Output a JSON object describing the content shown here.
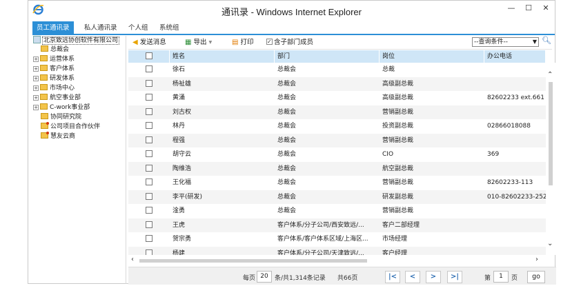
{
  "window": {
    "title": "通讯录 - Windows Internet Explorer"
  },
  "tabs": [
    {
      "label": "员工通讯录",
      "active": true
    },
    {
      "label": "私人通讯录",
      "active": false
    },
    {
      "label": "个人组",
      "active": false
    },
    {
      "label": "系统组",
      "active": false
    }
  ],
  "tree": {
    "root": "北京致远协创软件有限公司",
    "nodes": [
      {
        "label": "总裁会",
        "expandable": false
      },
      {
        "label": "运营体系",
        "expandable": true
      },
      {
        "label": "客户体系",
        "expandable": true
      },
      {
        "label": "研发体系",
        "expandable": true
      },
      {
        "label": "市场中心",
        "expandable": true
      },
      {
        "label": "航空事业部",
        "expandable": true
      },
      {
        "label": "C-work事业部",
        "expandable": true
      },
      {
        "label": "协同研究院",
        "expandable": false
      },
      {
        "label": "公司项目合作伙伴",
        "expandable": false,
        "icon": "partner"
      },
      {
        "label": "慧友云商",
        "expandable": false,
        "icon": "partner"
      }
    ]
  },
  "toolbar": {
    "send": "发送消息",
    "export": "导出",
    "print": "打印",
    "include_sub": "含子部门成员",
    "query_select": "--查询条件--"
  },
  "grid": {
    "columns": [
      "姓名",
      "部门",
      "岗位",
      "办公电话"
    ],
    "rows": [
      [
        "徐石",
        "总裁会",
        "总裁",
        ""
      ],
      [
        "杨祉雄",
        "总裁会",
        "高级副总裁",
        ""
      ],
      [
        "黄涌",
        "总裁会",
        "高级副总裁",
        "82602233 ext.661"
      ],
      [
        "刘古权",
        "总裁会",
        "营销副总裁",
        ""
      ],
      [
        "林丹",
        "总裁会",
        "投资副总裁",
        "02866018088"
      ],
      [
        "程强",
        "总裁会",
        "营销副总裁",
        ""
      ],
      [
        "胡守云",
        "总裁会",
        "CIO",
        "369"
      ],
      [
        "陶维浩",
        "总裁会",
        "航空副总裁",
        ""
      ],
      [
        "王化福",
        "总裁会",
        "营销副总裁",
        "82602233-113"
      ],
      [
        "李平(研发)",
        "总裁会",
        "研发副总裁",
        "010-82602233-252"
      ],
      [
        "淦勇",
        "总裁会",
        "营销副总裁",
        ""
      ],
      [
        "王虎",
        "客户体系/分子公司/西安致远/...",
        "客户二部经理",
        ""
      ],
      [
        "贺宗勇",
        "客户体系/客户体系区域/上海区...",
        "市场经理",
        ""
      ],
      [
        "杨建",
        "客户体系/分子公司/天津致远/...",
        "客户经理",
        ""
      ]
    ]
  },
  "pager": {
    "per_page_label": "每页",
    "per_page": "20",
    "summary": "条/共1,314条记录",
    "pages": "共66页",
    "page_label": "第",
    "page": "1",
    "page_suffix": "页",
    "go": "go"
  },
  "colors": {
    "accent": "#2c8fd6",
    "header": "#cfe6f7"
  }
}
